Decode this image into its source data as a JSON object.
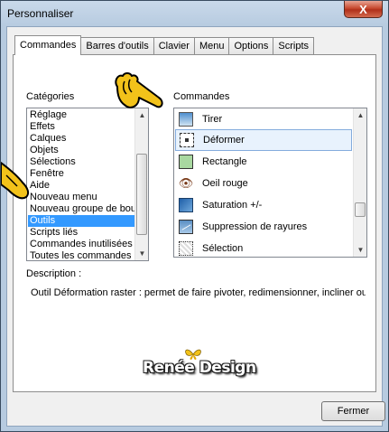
{
  "window": {
    "title": "Personnaliser",
    "close_label": "X"
  },
  "tabs": [
    {
      "label": "Commandes",
      "active": true
    },
    {
      "label": "Barres d'outils",
      "active": false
    },
    {
      "label": "Clavier",
      "active": false
    },
    {
      "label": "Menu",
      "active": false
    },
    {
      "label": "Options",
      "active": false
    },
    {
      "label": "Scripts",
      "active": false
    }
  ],
  "categories": {
    "label": "Catégories",
    "items": [
      "Réglage",
      "Effets",
      "Calques",
      "Objets",
      "Sélections",
      "Fenêtre",
      "Aide",
      "Nouveau menu",
      "Nouveau groupe de bout",
      "Outils",
      "Scripts liés",
      "Commandes inutilisées",
      "Toutes les commandes"
    ],
    "selected": "Outils"
  },
  "commands": {
    "label": "Commandes",
    "items": [
      {
        "label": "Tirer",
        "icon": "pull-icon"
      },
      {
        "label": "Déformer",
        "icon": "deform-icon"
      },
      {
        "label": "Rectangle",
        "icon": "rectangle-icon"
      },
      {
        "label": "Oeil rouge",
        "icon": "red-eye-icon"
      },
      {
        "label": "Saturation +/-",
        "icon": "saturation-icon"
      },
      {
        "label": "Suppression de rayures",
        "icon": "scratch-remover-icon"
      },
      {
        "label": "Sélection",
        "icon": "selection-icon"
      }
    ],
    "selected": "Déformer"
  },
  "description": {
    "label": "Description :",
    "text": "Outil Déformation raster : permet de faire pivoter, redimensionner, incliner ou de"
  },
  "watermark": {
    "text": "Renée Design"
  },
  "buttons": {
    "close_label": "Fermer"
  },
  "colors": {
    "selection": "#3399ff",
    "hover": "#e8f2fd",
    "accent_hand": "#f2c21a"
  }
}
